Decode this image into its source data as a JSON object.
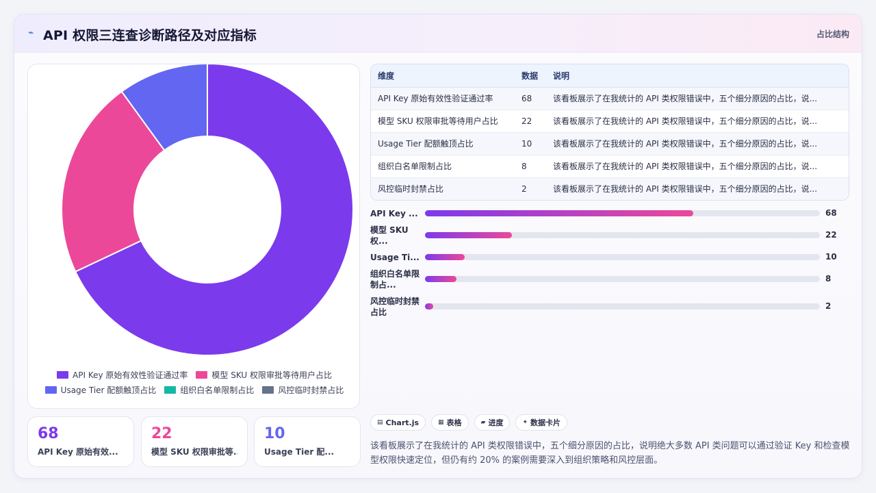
{
  "header": {
    "icon": "sparkline-icon",
    "title": "API 权限三连查诊断路径及对应指标",
    "right_label": "占比结构"
  },
  "colors": {
    "purple": "#7c3aed",
    "pink": "#ec4899",
    "indigo": "#6366f1",
    "teal": "#14b8a6",
    "slate": "#64748b"
  },
  "chart_data": {
    "type": "pie",
    "variant": "donut",
    "title": "",
    "categories": [
      "API Key 原始有效性验证通过率",
      "模型 SKU 权限审批等待用户占比",
      "Usage Tier 配额触顶占比",
      "组织白名单限制占比",
      "风控临时封禁占比"
    ],
    "values": [
      68,
      22,
      10,
      8,
      2
    ],
    "colors": [
      "#7c3aed",
      "#ec4899",
      "#6366f1",
      "#14b8a6",
      "#64748b"
    ],
    "legend": "bottom"
  },
  "legend": {
    "row1": [
      {
        "label": "API Key 原始有效性验证通过率",
        "color": "#7c3aed"
      },
      {
        "label": "模型 SKU 权限审批等待用户占比",
        "color": "#ec4899"
      }
    ],
    "row2": [
      {
        "label": "Usage Tier 配额触顶占比",
        "color": "#6366f1"
      },
      {
        "label": "组织白名单限制占比",
        "color": "#14b8a6"
      },
      {
        "label": "风控临时封禁占比",
        "color": "#64748b"
      }
    ]
  },
  "table": {
    "headers": [
      "维度",
      "数据",
      "说明"
    ],
    "rows": [
      {
        "dim": "API Key 原始有效性验证通过率",
        "value": "68",
        "desc": "该看板展示了在我统计的 API 类权限错误中，五个细分原因的占比，说..."
      },
      {
        "dim": "模型 SKU 权限审批等待用户占比",
        "value": "22",
        "desc": "该看板展示了在我统计的 API 类权限错误中，五个细分原因的占比，说..."
      },
      {
        "dim": "Usage Tier 配额触顶占比",
        "value": "10",
        "desc": "该看板展示了在我统计的 API 类权限错误中，五个细分原因的占比，说..."
      },
      {
        "dim": "组织白名单限制占比",
        "value": "8",
        "desc": "该看板展示了在我统计的 API 类权限错误中，五个细分原因的占比，说..."
      },
      {
        "dim": "风控临时封禁占比",
        "value": "2",
        "desc": "该看板展示了在我统计的 API 类权限错误中，五个细分原因的占比，说..."
      }
    ]
  },
  "progress": [
    {
      "label": "API Key ...",
      "value": 68,
      "fraction": 0.68
    },
    {
      "label": "模型 SKU 权...",
      "value": 22,
      "fraction": 0.22
    },
    {
      "label": "Usage Ti...",
      "value": 10,
      "fraction": 0.1
    },
    {
      "label": "组织白名单限制占...",
      "value": 8,
      "fraction": 0.08
    },
    {
      "label": "风控临时封禁占比",
      "value": 2,
      "fraction": 0.02
    }
  ],
  "kpis": [
    {
      "value": "68",
      "label": "API Key 原始有效...",
      "color": "#7c3aed"
    },
    {
      "value": "22",
      "label": "模型 SKU 权限审批等...",
      "color": "#ec4899"
    },
    {
      "value": "10",
      "label": "Usage Tier 配...",
      "color": "#6366f1"
    }
  ],
  "chips": [
    {
      "icon": "chart-icon",
      "glyph": "▤",
      "label": "Chart.js"
    },
    {
      "icon": "table-icon",
      "glyph": "▦",
      "label": "表格"
    },
    {
      "icon": "progress-icon",
      "glyph": "▰",
      "label": "进度"
    },
    {
      "icon": "sparkle-icon",
      "glyph": "✦",
      "label": "数据卡片"
    }
  ],
  "summary": "该看板展示了在我统计的 API 类权限错误中，五个细分原因的占比，说明绝大多数 API 类问题可以通过验证 Key 和检查模型权限快速定位，但仍有约 20% 的案例需要深入到组织策略和风控层面。"
}
